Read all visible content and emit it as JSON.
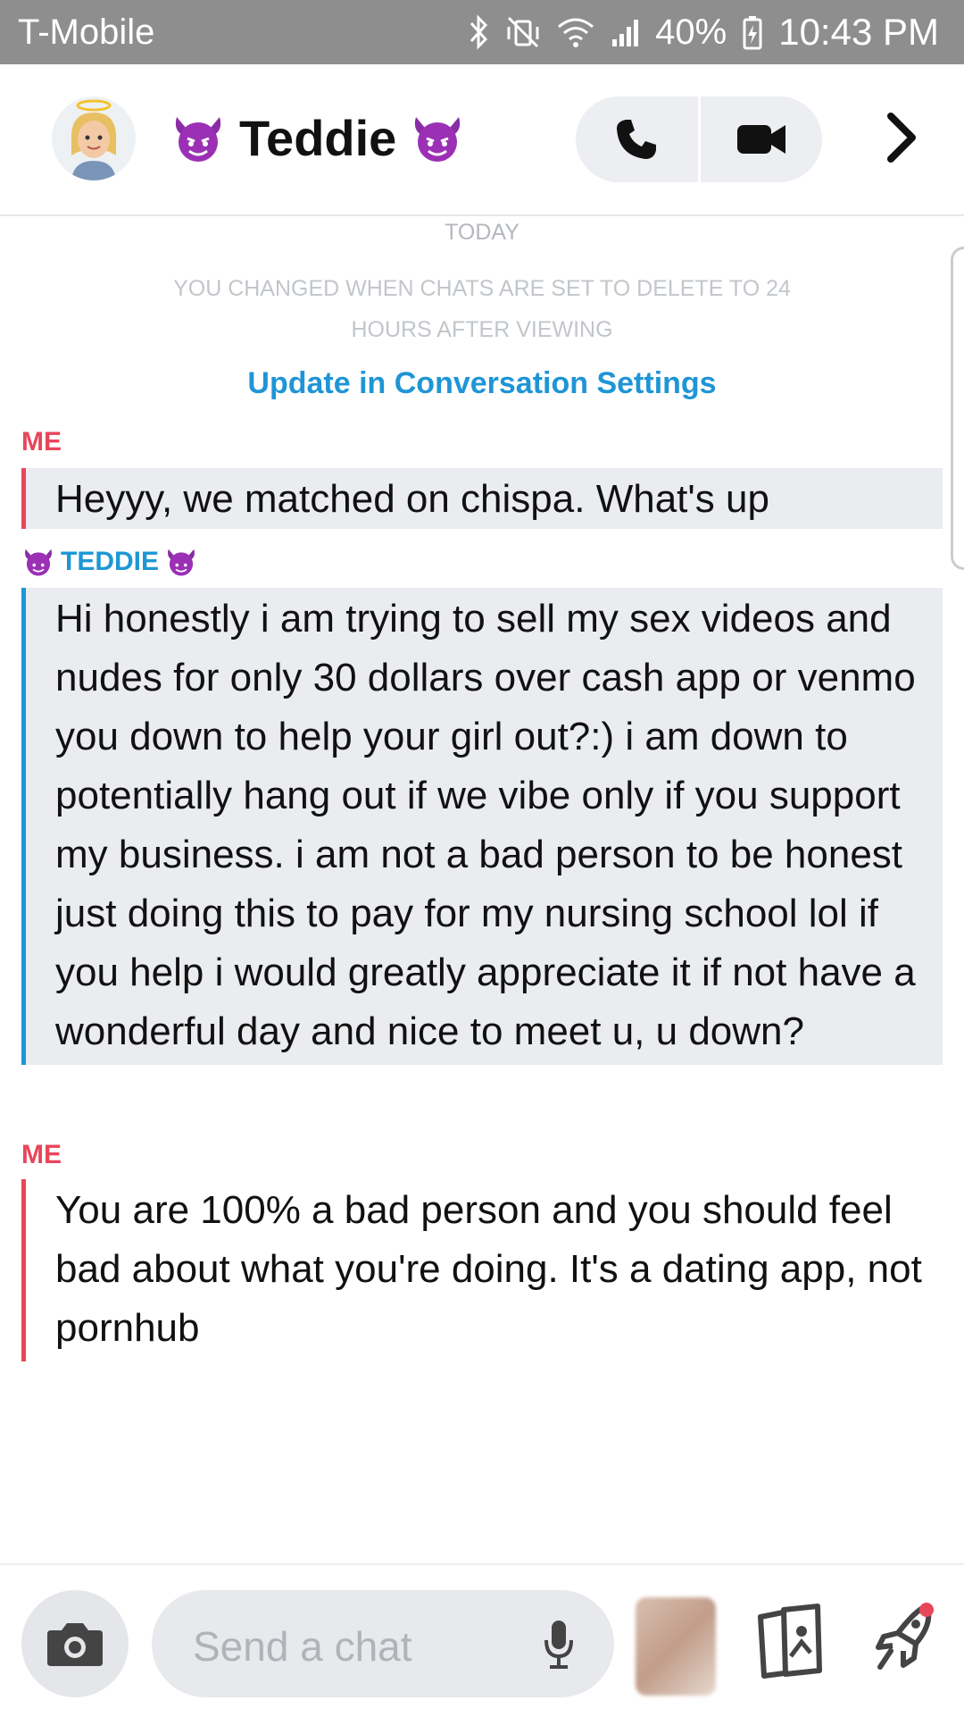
{
  "status_bar": {
    "carrier": "T-Mobile",
    "battery": "40%",
    "time": "10:43 PM"
  },
  "header": {
    "title": "Teddie",
    "title_emoji": "devil-emoji"
  },
  "chat": {
    "date_label": "TODAY",
    "system_notice": "YOU CHANGED WHEN CHATS ARE SET TO DELETE TO 24 HOURS AFTER VIEWING",
    "settings_link": "Update in Conversation Settings",
    "messages": [
      {
        "sender": "ME",
        "text": "Heyyy, we matched on chispa. What's up"
      },
      {
        "sender": "TEDDIE",
        "text": "Hi honestly i am trying to sell my sex videos and nudes for only 30 dollars over cash app or venmo you down to help your girl out?:) i am down to potentially hang out if we vibe only if you support my business. i am not a bad person to be honest just doing this to pay for my nursing school lol if you help i would greatly appreciate it if not have a wonderful day and nice to meet u, u down?"
      },
      {
        "sender": "ME",
        "text": "You are 100% a bad person and you should feel bad about what you're doing. It's a dating app, not pornhub"
      }
    ]
  },
  "footer": {
    "input_placeholder": "Send a chat"
  },
  "colors": {
    "me": "#e8465a",
    "them": "#1e97d4",
    "link": "#1f95d6",
    "bubble_bg": "#eaecef"
  }
}
